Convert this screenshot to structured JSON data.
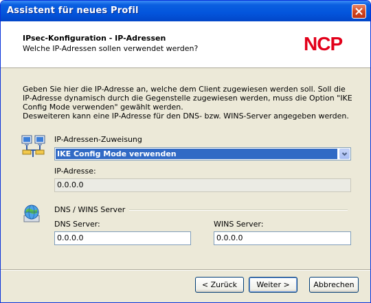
{
  "window": {
    "title": "Assistent für neues Profil"
  },
  "header": {
    "title": "IPsec-Konfiguration - IP-Adressen",
    "subtitle": "Welche IP-Adressen sollen verwendet werden?",
    "logo_text": "NCP"
  },
  "description": [
    "Geben Sie hier die IP-Adresse an, welche dem Client zugewiesen werden soll. Soll die",
    "IP-Adresse dynamisch durch die Gegenstelle zugewiesen werden, muss die Option \"IKE",
    "Config Mode verwenden\" gewählt werden.",
    "Desweiteren kann eine IP-Adresse für den DNS- bzw. WINS-Server angegeben werden."
  ],
  "ip_assignment": {
    "label": "IP-Adressen-Zuweisung",
    "selected": "IKE Config Mode verwenden",
    "ip_label": "IP-Adresse:",
    "ip_value": "0.0.0.0"
  },
  "dns_wins": {
    "group_label": "DNS / WINS Server",
    "dns_label": "DNS Server:",
    "dns_value": "0.0.0.0",
    "wins_label": "WINS Server:",
    "wins_value": "0.0.0.0"
  },
  "buttons": {
    "back": "< Zurück",
    "next": "Weiter >",
    "cancel": "Abbrechen"
  },
  "icons": [
    "close-icon",
    "network-computers-icon",
    "dns-globe-icon",
    "dropdown-arrow-icon"
  ],
  "colors": {
    "titlebar": "#0355dc",
    "selection": "#316ac5",
    "logo_red": "#e2001a",
    "dialog_bg": "#ece9d8"
  }
}
